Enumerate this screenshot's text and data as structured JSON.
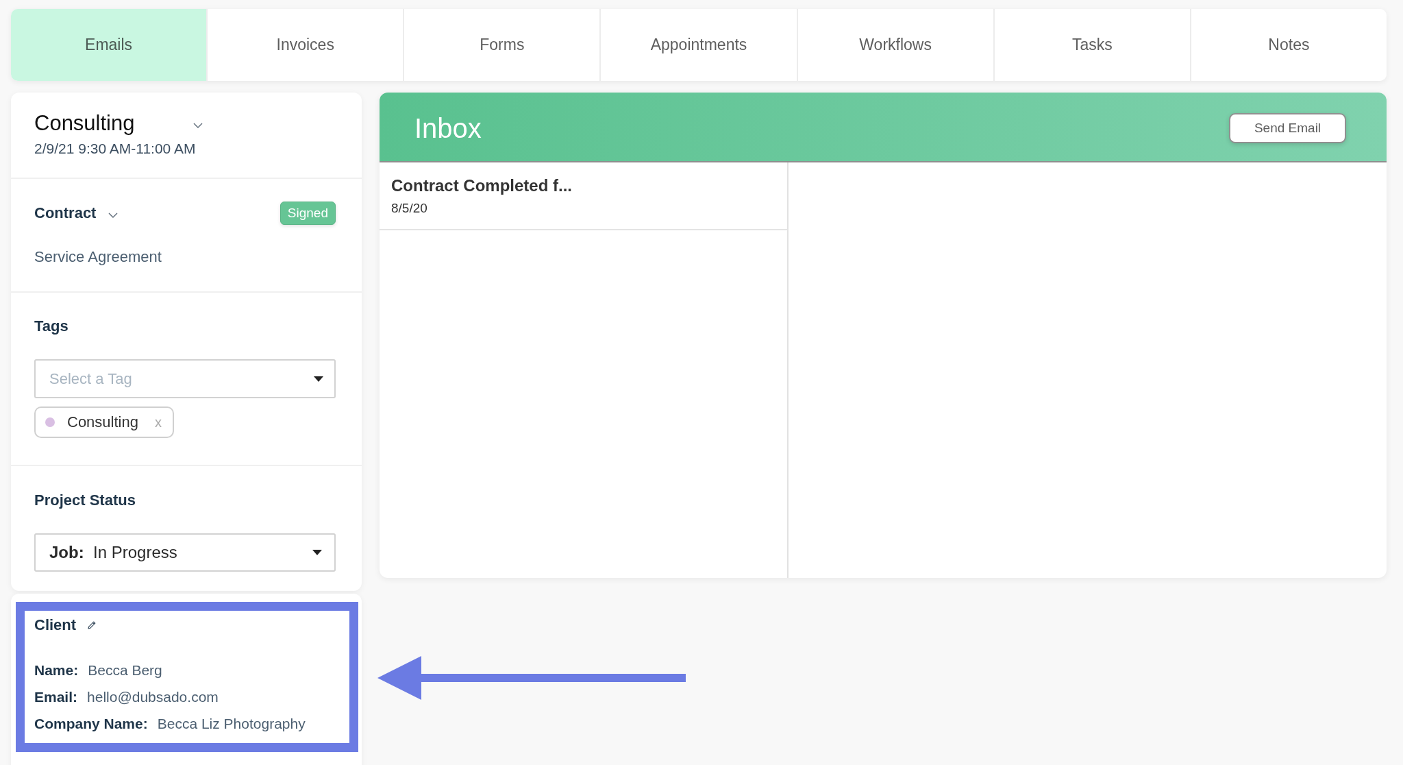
{
  "tabs": [
    {
      "label": "Emails",
      "selected": true
    },
    {
      "label": "Invoices",
      "selected": false
    },
    {
      "label": "Forms",
      "selected": false
    },
    {
      "label": "Appointments",
      "selected": false
    },
    {
      "label": "Workflows",
      "selected": false
    },
    {
      "label": "Tasks",
      "selected": false
    },
    {
      "label": "Notes",
      "selected": false
    }
  ],
  "event": {
    "title": "Consulting",
    "date_range": "2/9/21 9:30 AM-11:00 AM"
  },
  "contract": {
    "label": "Contract",
    "status": "Signed",
    "name": "Service Agreement"
  },
  "tags": {
    "label": "Tags",
    "select": {
      "placeholder": "Select a Tag"
    },
    "chips": [
      {
        "label": "Consulting",
        "color": "#d9bfe3",
        "remove": "x"
      }
    ]
  },
  "project_status": {
    "label": "Project Status",
    "select": {
      "value": "**Job:**  In Progress"
    }
  },
  "client": {
    "label": "Client",
    "highlighted": true,
    "fields": [
      {
        "label": "Name:",
        "value": "Becca Berg"
      },
      {
        "label": "Email:",
        "value": "hello@dubsado.com"
      },
      {
        "label": "Company Name:",
        "value": "Becca Liz Photography"
      }
    ]
  },
  "inbox": {
    "title": "Inbox",
    "send_button": "Send Email",
    "emails": [
      {
        "subject": "Contract Completed f...",
        "date": "8/5/20"
      }
    ]
  }
}
